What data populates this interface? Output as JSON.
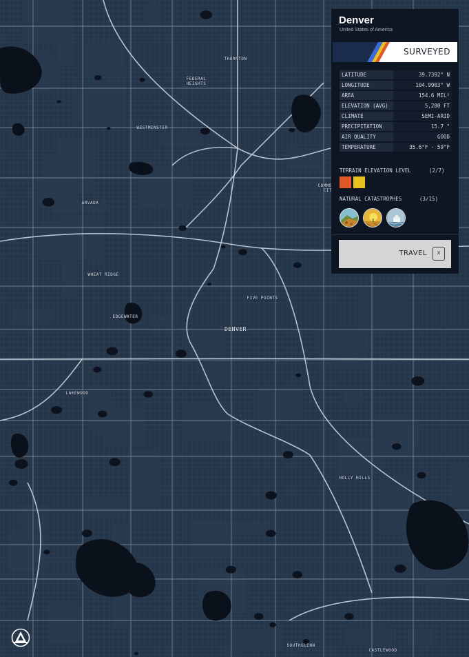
{
  "city": {
    "name": "Denver",
    "country": "United States of America",
    "status": "SURVEYED"
  },
  "stats": [
    {
      "label": "LATITUDE",
      "value": "39.7392° N"
    },
    {
      "label": "LONGITUDE",
      "value": "104.9903° W"
    },
    {
      "label": "AREA",
      "value": "154.6 MIL²"
    },
    {
      "label": "ELEVATION (AVG)",
      "value": "5,280 FT"
    },
    {
      "label": "CLIMATE",
      "value": "SEMI-ARID"
    },
    {
      "label": "PRECIPITATION",
      "value": "15.7 \""
    },
    {
      "label": "AIR QUALITY",
      "value": "GOOD"
    },
    {
      "label": "TEMPERATURE",
      "value": "35.6°F - 59°F"
    }
  ],
  "terrain": {
    "label": "TERRAIN ELEVATION LEVEL",
    "count": "(2/7)",
    "swatches": [
      "#e0582a",
      "#e9c11e"
    ]
  },
  "catastrophes": {
    "label": "NATURAL CATASTROPHES",
    "count": "(3/15)",
    "icons": [
      "landslide-icon",
      "drought-icon",
      "flood-icon"
    ]
  },
  "travel": {
    "label": "TRAVEL",
    "key": "X"
  },
  "map": {
    "places": [
      {
        "name": "THORNTON",
        "big": false
      },
      {
        "name": "FEDERAL\nHEIGHTS",
        "big": false
      },
      {
        "name": "WESTMINSTER",
        "big": false
      },
      {
        "name": "COMMERCE\nCITY",
        "big": false
      },
      {
        "name": "ARVADA",
        "big": false
      },
      {
        "name": "WHEAT RIDGE",
        "big": false
      },
      {
        "name": "FIVE POINTS",
        "big": false
      },
      {
        "name": "EDGEWATER",
        "big": false
      },
      {
        "name": "DENVER",
        "big": true
      },
      {
        "name": "LAKEWOOD",
        "big": false
      },
      {
        "name": "HOLLY HILLS",
        "big": false
      },
      {
        "name": "SOUTHGLENN",
        "big": false
      },
      {
        "name": "CASTLEWOOD",
        "big": false
      }
    ]
  },
  "colors": {
    "map_bg": "#26364a",
    "water": "#0b111b",
    "panel_bg": "#0e1624",
    "accent_red": "#e0582a",
    "accent_yellow": "#e9c11e"
  }
}
